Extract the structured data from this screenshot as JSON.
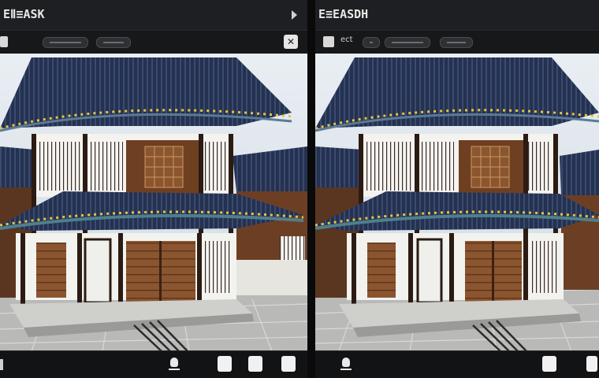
{
  "left_pane": {
    "title": "EⅡ≡ASK",
    "toolbar": {
      "label": ""
    },
    "photo": {
      "subject-icon": "hanok-building",
      "sky": "#dfe8f0"
    }
  },
  "right_pane": {
    "title": "E≡EASDH",
    "toolbar": {
      "label": "ect"
    },
    "photo": {
      "subject-icon": "hanok-building",
      "sky": "#dfe8f0"
    }
  },
  "icons": {
    "play": "play-icon",
    "close": "close-icon",
    "brush": "brush-icon"
  },
  "colors": {
    "roof": "#1f2a44",
    "wood": "#7b4a2a",
    "wall": "#f2f2ee",
    "trim": "#e6c341"
  }
}
